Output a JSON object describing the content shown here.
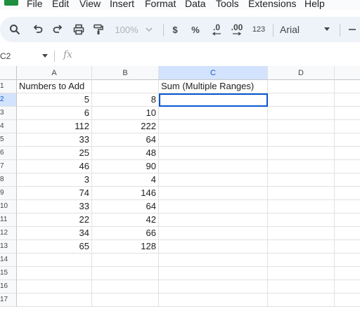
{
  "menu": [
    "File",
    "Edit",
    "View",
    "Insert",
    "Format",
    "Data",
    "Tools",
    "Extensions",
    "Help"
  ],
  "toolbar": {
    "zoom": "100%",
    "currency": "$",
    "percent": "%",
    "decrease_decimal": ".0",
    "increase_decimal": ".00",
    "number_format": "123",
    "font": "Arial"
  },
  "namebox": "C2",
  "fx_label": "fx",
  "columns": [
    "A",
    "B",
    "C",
    "D"
  ],
  "selected_column": "C",
  "selected_row": "2",
  "active_cell": "C2",
  "rows": [
    {
      "n": "1",
      "a": "Numbers to Add",
      "b": "",
      "c": "Sum (Multiple Ranges)"
    },
    {
      "n": "2",
      "a": "5",
      "b": "8",
      "c": ""
    },
    {
      "n": "3",
      "a": "6",
      "b": "10",
      "c": ""
    },
    {
      "n": "4",
      "a": "112",
      "b": "222",
      "c": ""
    },
    {
      "n": "5",
      "a": "33",
      "b": "64",
      "c": ""
    },
    {
      "n": "6",
      "a": "25",
      "b": "48",
      "c": ""
    },
    {
      "n": "7",
      "a": "46",
      "b": "90",
      "c": ""
    },
    {
      "n": "8",
      "a": "3",
      "b": "4",
      "c": ""
    },
    {
      "n": "9",
      "a": "74",
      "b": "146",
      "c": ""
    },
    {
      "n": "10",
      "a": "33",
      "b": "64",
      "c": ""
    },
    {
      "n": "11",
      "a": "22",
      "b": "42",
      "c": ""
    },
    {
      "n": "12",
      "a": "34",
      "b": "66",
      "c": ""
    },
    {
      "n": "13",
      "a": "65",
      "b": "128",
      "c": ""
    },
    {
      "n": "14",
      "a": "",
      "b": "",
      "c": ""
    },
    {
      "n": "15",
      "a": "",
      "b": "",
      "c": ""
    },
    {
      "n": "16",
      "a": "",
      "b": "",
      "c": ""
    },
    {
      "n": "17",
      "a": "",
      "b": "",
      "c": ""
    }
  ],
  "colors": {
    "accent": "#0b57d0",
    "selected_header": "#d3e3fd",
    "brand": "#1e8e3e"
  }
}
